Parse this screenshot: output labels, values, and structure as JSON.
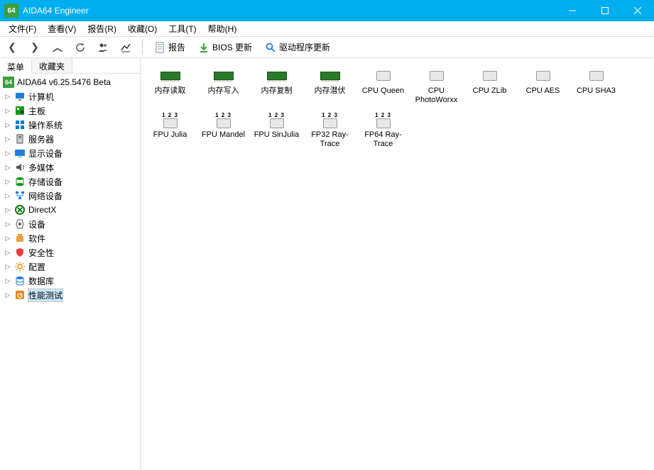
{
  "window": {
    "title": "AIDA64 Engineer",
    "logo": "64"
  },
  "menubar": [
    {
      "label": "文件(F)"
    },
    {
      "label": "查看(V)"
    },
    {
      "label": "报告(R)"
    },
    {
      "label": "收藏(O)"
    },
    {
      "label": "工具(T)"
    },
    {
      "label": "帮助(H)"
    }
  ],
  "toolbar": {
    "report_label": "报告",
    "bios_label": "BIOS 更新",
    "driver_label": "驱动程序更新"
  },
  "sidebar": {
    "tabs": [
      {
        "label": "菜单"
      },
      {
        "label": "收藏夹"
      }
    ],
    "root": {
      "label": "AIDA64 v6.25.5476 Beta"
    },
    "items": [
      {
        "label": "计算机",
        "icon": "monitor",
        "color": "#1e7fd6"
      },
      {
        "label": "主板",
        "icon": "board",
        "color": "#139c13"
      },
      {
        "label": "操作系统",
        "icon": "windows",
        "color": "#0078d7"
      },
      {
        "label": "服务器",
        "icon": "server",
        "color": "#555"
      },
      {
        "label": "显示设备",
        "icon": "display",
        "color": "#1e7fd6"
      },
      {
        "label": "多媒体",
        "icon": "speaker",
        "color": "#555"
      },
      {
        "label": "存储设备",
        "icon": "storage",
        "color": "#139c13"
      },
      {
        "label": "网络设备",
        "icon": "network",
        "color": "#1e7fd6"
      },
      {
        "label": "DirectX",
        "icon": "directx",
        "color": "#107c10"
      },
      {
        "label": "设备",
        "icon": "device",
        "color": "#555"
      },
      {
        "label": "软件",
        "icon": "software",
        "color": "#e8a33d"
      },
      {
        "label": "安全性",
        "icon": "shield",
        "color": "#e83d3d"
      },
      {
        "label": "配置",
        "icon": "config",
        "color": "#e8a33d"
      },
      {
        "label": "数据库",
        "icon": "database",
        "color": "#1e7fd6"
      },
      {
        "label": "性能测试",
        "icon": "benchmark",
        "color": "#e88b1e"
      }
    ],
    "selected_index": 14
  },
  "benchmarks": [
    {
      "label": "内存读取",
      "type": "ram"
    },
    {
      "label": "内存写入",
      "type": "ram"
    },
    {
      "label": "内存复制",
      "type": "ram"
    },
    {
      "label": "内存潜伏",
      "type": "ram"
    },
    {
      "label": "CPU Queen",
      "type": "cpu"
    },
    {
      "label": "CPU PhotoWorxx",
      "type": "cpu"
    },
    {
      "label": "CPU ZLib",
      "type": "cpu"
    },
    {
      "label": "CPU AES",
      "type": "cpu"
    },
    {
      "label": "CPU SHA3",
      "type": "cpu"
    },
    {
      "label": "FPU Julia",
      "type": "fpu"
    },
    {
      "label": "FPU Mandel",
      "type": "fpu"
    },
    {
      "label": "FPU SinJulia",
      "type": "fpu"
    },
    {
      "label": "FP32 Ray-Trace",
      "type": "fpu"
    },
    {
      "label": "FP64 Ray-Trace",
      "type": "fpu"
    }
  ]
}
